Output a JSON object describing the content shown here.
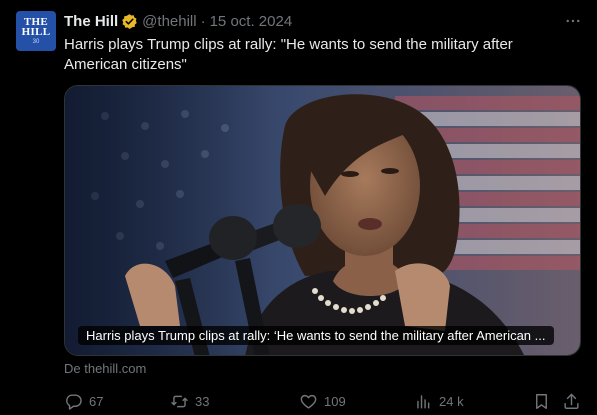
{
  "author": {
    "name": "The Hill",
    "handle": "@thehill",
    "separator": "·",
    "date": "15 oct. 2024",
    "avatar": {
      "line1": "THE",
      "line2": "HILL",
      "line3": "30"
    }
  },
  "tweet": {
    "text": "Harris plays Trump clips at rally: \"He wants to send the military after American citizens\""
  },
  "link_card": {
    "caption": "Harris plays Trump clips at rally: ‘He wants to send the military after American ...",
    "source": "De thehill.com"
  },
  "actions": {
    "replies": "67",
    "reposts": "33",
    "likes": "109",
    "views": "24 k"
  },
  "icons": {
    "verified": "verified-badge-icon",
    "more": "more-icon",
    "reply": "reply-icon",
    "repost": "repost-icon",
    "like": "heart-icon",
    "views": "views-icon",
    "bookmark": "bookmark-icon",
    "share": "share-icon"
  },
  "colors": {
    "background": "#000000",
    "text_primary": "#e7e9ea",
    "text_secondary": "#71767b",
    "verified": "#e8b829",
    "avatar_bg": "#2450a8"
  }
}
